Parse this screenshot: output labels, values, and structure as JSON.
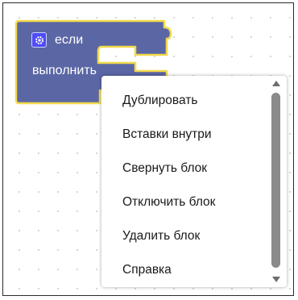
{
  "block": {
    "label_if": "если",
    "label_do": "выполнить",
    "color": "#5b67a5",
    "highlight_color": "#f2d94b"
  },
  "context_menu": {
    "items": [
      "Дублировать",
      "Вставки внутри",
      "Свернуть блок",
      "Отключить блок",
      "Удалить блок",
      "Справка"
    ]
  },
  "icons": {
    "mutator": "gear-icon",
    "scroll_up": "arrow-up-icon",
    "scroll_down": "arrow-down-icon"
  }
}
